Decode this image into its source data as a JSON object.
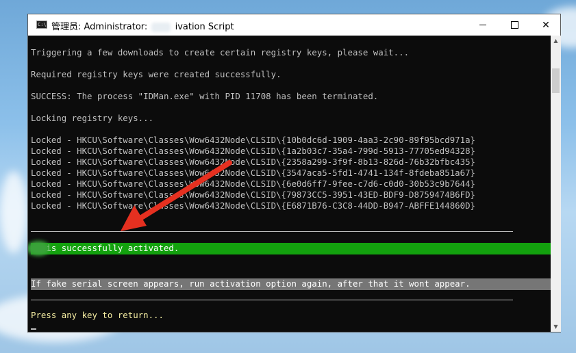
{
  "window": {
    "title_prefix": "管理员: Administrator:",
    "title_suffix": "ivation Script",
    "app_icon_text": "C:\\"
  },
  "console": {
    "lines": [
      "Triggering a few downloads to create certain registry keys, please wait...",
      "Required registry keys were created successfully.",
      "SUCCESS: The process \"IDMan.exe\" with PID 11708 has been terminated.",
      "Locking registry keys...",
      "Locked - HKCU\\Software\\Classes\\Wow6432Node\\CLSID\\{10b0dc6d-1909-4aa3-2c90-89f95bcd971a}",
      "Locked - HKCU\\Software\\Classes\\Wow6432Node\\CLSID\\{1a2b03c7-35a4-799d-5913-77705ed94328}",
      "Locked - HKCU\\Software\\Classes\\Wow6432Node\\CLSID\\{2358a299-3f9f-8b13-826d-76b32bfbc435}",
      "Locked - HKCU\\Software\\Classes\\Wow6432Node\\CLSID\\{3547aca5-5fd1-4741-134f-8fdeba851a67}",
      "Locked - HKCU\\Software\\Classes\\Wow6432Node\\CLSID\\{6e0d6ff7-9fee-c7d6-c0d0-30b53c9b7644}",
      "Locked - HKCU\\Software\\Classes\\Wow6432Node\\CLSID\\{79873CC5-3951-43ED-BDF9-D8759474B6FD}",
      "Locked - HKCU\\Software\\Classes\\Wow6432Node\\CLSID\\{E6871B76-C3C8-44DD-B947-ABFFE144860D}"
    ],
    "success_line": "   is successfully activated.",
    "hint_line": "If fake serial screen appears, run activation option again, after that it wont appear.",
    "prompt_line": "Press any key to return..."
  },
  "colors": {
    "console_bg": "#0c0c0c",
    "console_text": "#c0c0c0",
    "success_bar": "#13a10e",
    "hint_bar": "#767676",
    "prompt_text": "#f9f1a5",
    "arrow": "#e53020"
  },
  "icons": {
    "app": "console-icon",
    "minimize": "minimize-icon",
    "maximize": "maximize-icon",
    "close": "close-icon",
    "annotation": "red-arrow-icon"
  }
}
